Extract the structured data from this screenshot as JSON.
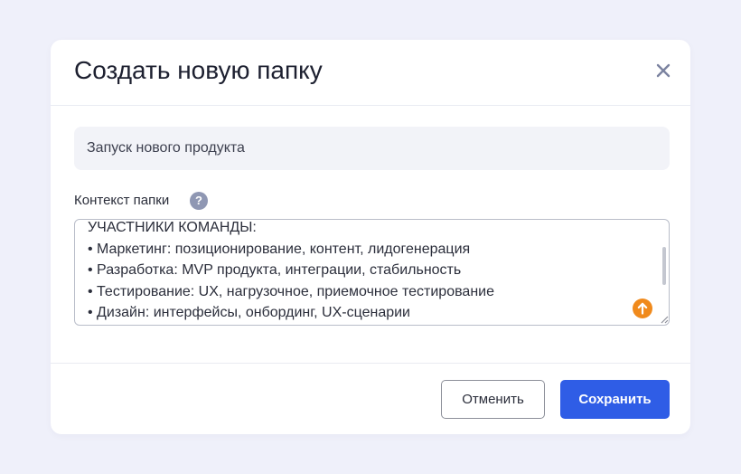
{
  "dialog": {
    "title": "Создать новую папку",
    "close_icon": "close-icon"
  },
  "folder_name": {
    "value": "Запуск нового продукта",
    "placeholder": ""
  },
  "context": {
    "label": "Контекст папки",
    "help_icon": "question-circle-icon",
    "help_glyph": "?",
    "text": "УЧАСТНИКИ КОМАНДЫ:\n• Маркетинг: позиционирование, контент, лидогенерация\n• Разработка: MVP продукта, интеграции, стабильность\n• Тестирование: UX, нагрузочное, приемочное тестирование\n• Дизайн: интерфейсы, онбординг, UX-сценарии",
    "badge_icon": "arrow-up-icon",
    "badge_color": "#f08a1c"
  },
  "footer": {
    "cancel_label": "Отменить",
    "save_label": "Сохранить"
  },
  "colors": {
    "background": "#eff0fa",
    "accent": "#2f5de6",
    "help_icon": "#8f97b3"
  }
}
